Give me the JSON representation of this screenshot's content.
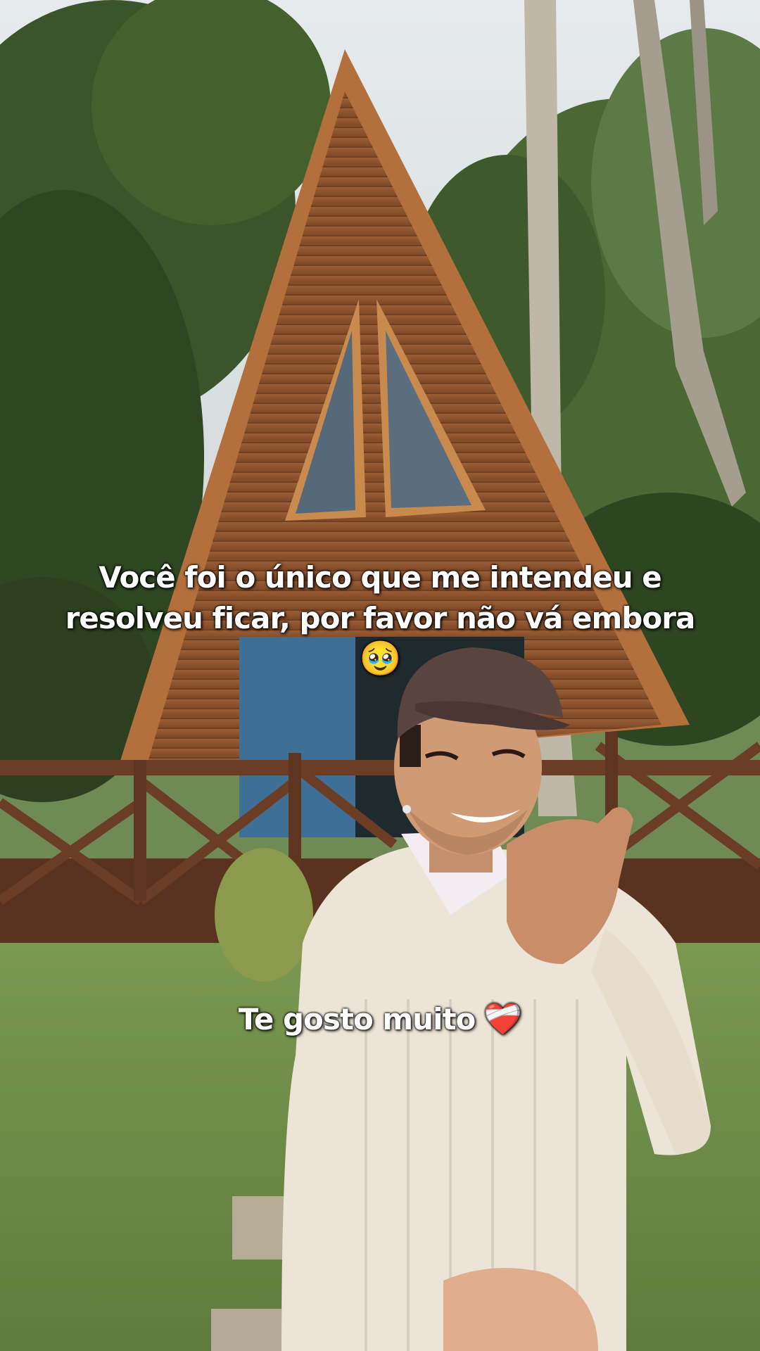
{
  "captions": {
    "top_line_1": "Você foi o único que  me intendeu e",
    "top_line_2": "resolveu ficar, por favor não vá embora",
    "top_emoji": "🥹",
    "bottom_text": "Te gosto muito",
    "bottom_emoji": "❤️‍🩹"
  },
  "colors": {
    "sky": "#d9dfe2",
    "foliage": "#3e5a2a",
    "cabin_wood": "#8a5230",
    "cabin_trim": "#b9733c",
    "grass": "#6f8a4c",
    "sweater": "#ece4d6",
    "cap": "#5a4440"
  }
}
